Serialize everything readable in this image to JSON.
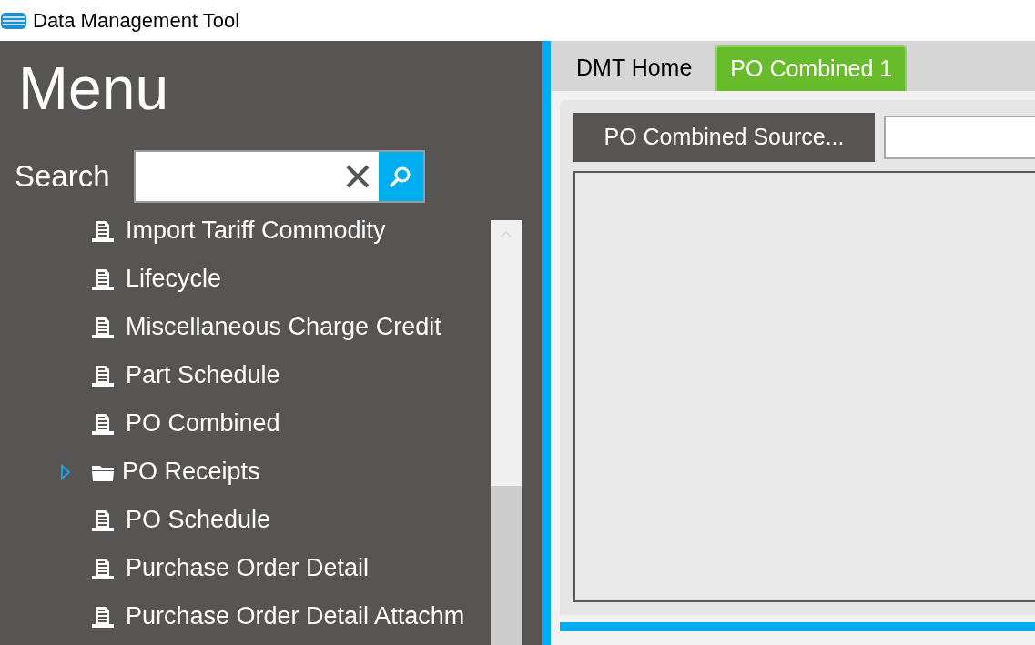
{
  "window": {
    "title": "Data Management Tool"
  },
  "menu": {
    "title": "Menu",
    "search": {
      "label": "Search"
    },
    "items": [
      {
        "label": "Import Tariff Commodity",
        "kind": "document"
      },
      {
        "label": "Lifecycle",
        "kind": "document"
      },
      {
        "label": "Miscellaneous Charge Credit",
        "kind": "document"
      },
      {
        "label": "Part Schedule",
        "kind": "document"
      },
      {
        "label": "PO Combined",
        "kind": "document"
      },
      {
        "label": "PO Receipts",
        "kind": "folder",
        "expanded": false
      },
      {
        "label": "PO Schedule",
        "kind": "document"
      },
      {
        "label": "Purchase Order Detail",
        "kind": "document"
      },
      {
        "label": "Purchase Order Detail Attachm",
        "kind": "document"
      }
    ]
  },
  "tabs": [
    {
      "label": "DMT Home",
      "selected": false
    },
    {
      "label": "PO Combined 1",
      "selected": true
    }
  ],
  "content": {
    "source_button": "PO Combined Source..."
  }
}
